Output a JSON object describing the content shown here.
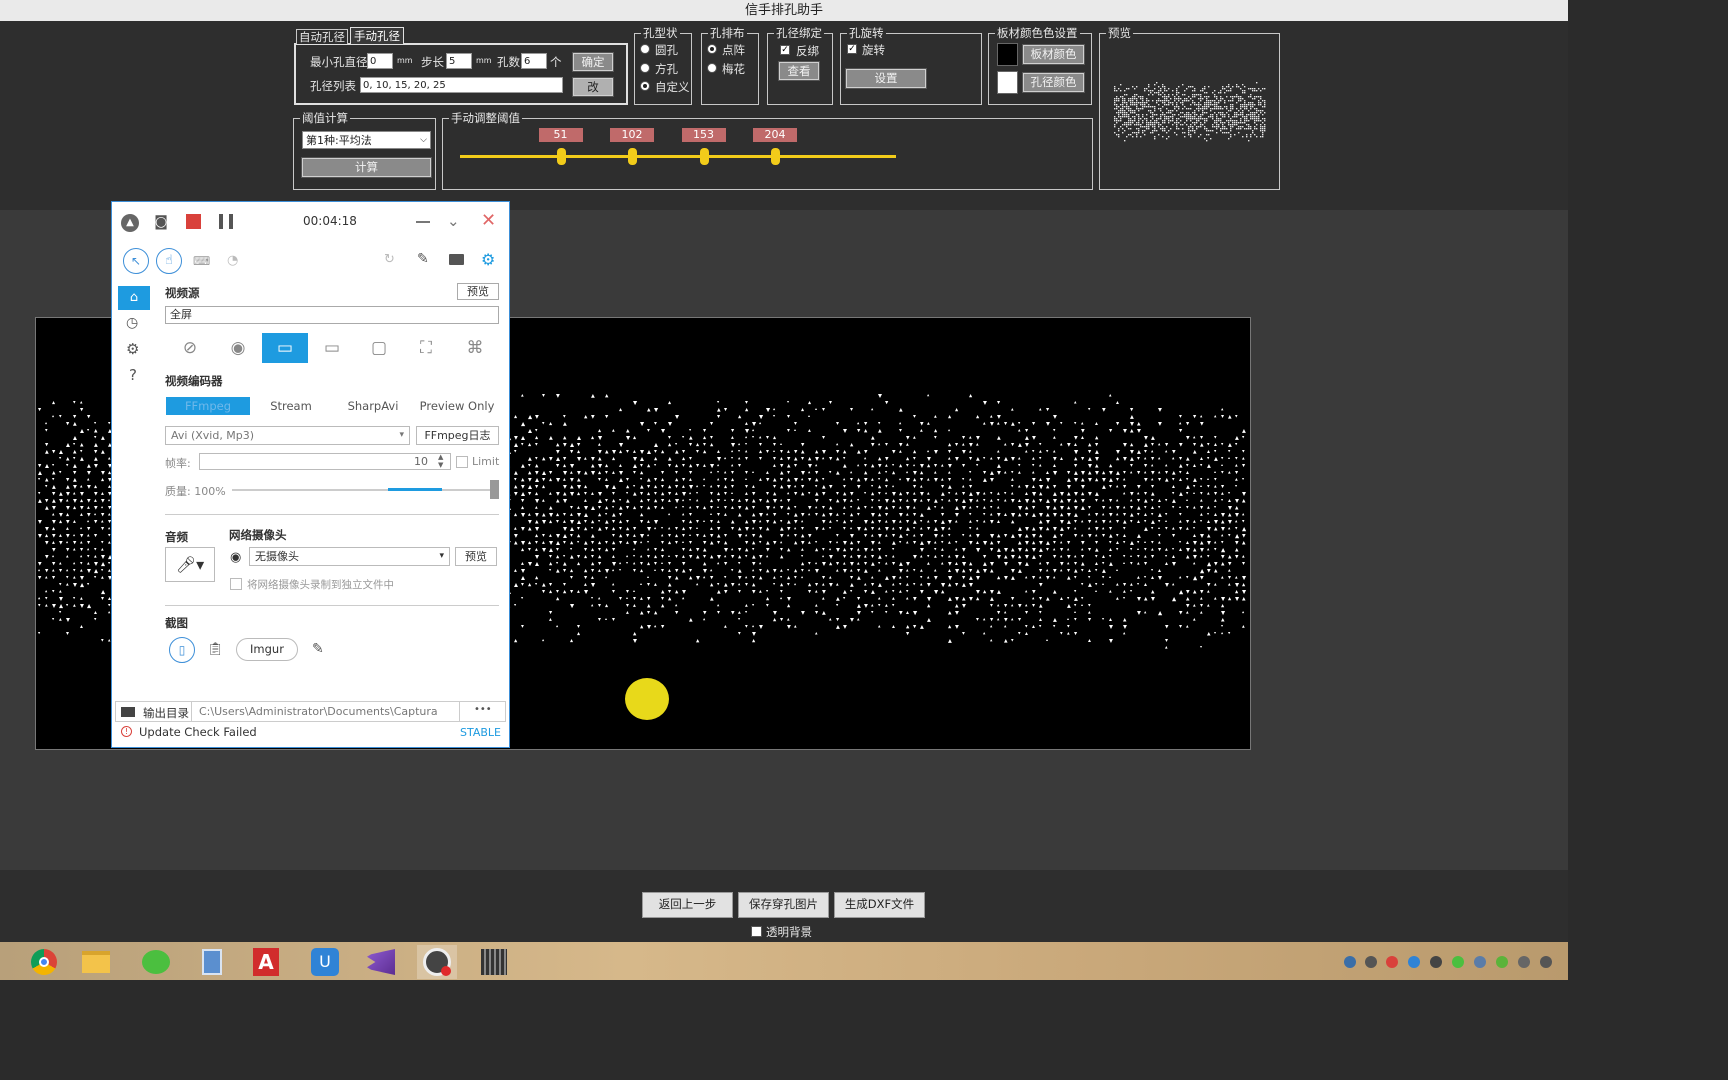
{
  "app": {
    "title": "信手排孔助手"
  },
  "aperture": {
    "tabs": [
      "自动孔径",
      "手动孔径"
    ],
    "active_tab": "手动孔径",
    "min_diameter_label": "最小孔直径",
    "min_diameter_value": "0",
    "unit_mm": "mm",
    "step_label": "步长",
    "step_value": "5",
    "count_label": "孔数",
    "count_value": "6",
    "count_unit": "个",
    "confirm_label": "确定",
    "list_label": "孔径列表",
    "list_value": "0, 10, 15, 20, 25",
    "edit_label": "改"
  },
  "hole_shape": {
    "title": "孔型状",
    "options": [
      "圆孔",
      "方孔",
      "自定义"
    ],
    "selected": "自定义"
  },
  "hole_layout": {
    "title": "孔排布",
    "options": [
      "点阵",
      "梅花"
    ],
    "selected": "点阵"
  },
  "hole_bind": {
    "title": "孔径绑定",
    "reverse_label": "反绑",
    "reverse_checked": true,
    "view_label": "查看"
  },
  "hole_rotate": {
    "title": "孔旋转",
    "rotate_label": "旋转",
    "rotate_checked": true,
    "settings_label": "设置"
  },
  "color_settings": {
    "title": "板材颜色色设置",
    "board_label": "板材颜色",
    "hole_label": "孔径颜色",
    "board_color": "#000000",
    "hole_color": "#ffffff"
  },
  "preview": {
    "title": "预览"
  },
  "threshold": {
    "title": "阈值计算",
    "method": "第1种:平均法",
    "calc_label": "计算"
  },
  "manual_threshold": {
    "title": "手动调整阈值",
    "values": [
      51,
      102,
      153,
      204
    ],
    "slider_max": 255
  },
  "captura": {
    "timer": "00:04:18",
    "video_source_label": "视频源",
    "preview_label": "预览",
    "source_value": "全屏",
    "encoder_label": "视频编码器",
    "encoder_tabs": [
      "FFmpeg",
      "Stream",
      "SharpAvi",
      "Preview Only"
    ],
    "active_encoder": "FFmpeg",
    "codec": "Avi (Xvid, Mp3)",
    "ffmpeg_log_label": "FFmpeg日志",
    "fps_label": "帧率:",
    "fps_value": "10",
    "limit_label": "Limit",
    "quality_label": "质量: 100%",
    "quality_percent": 100,
    "audio_label": "音频",
    "webcam_label": "网络摄像头",
    "webcam_value": "无摄像头",
    "webcam_preview_label": "预览",
    "webcam_separate_label": "将网络摄像头录制到独立文件中",
    "screenshot_label": "截图",
    "imgur_label": "Imgur",
    "output_dir_label": "输出目录",
    "output_dir_value": "C:\\Users\\Administrator\\Documents\\Captura",
    "more_label": "•••",
    "update_status": "Update Check Failed",
    "channel": "STABLE",
    "accent_color": "#1e9be0"
  },
  "bottom": {
    "back_label": "返回上一步",
    "save_label": "保存穿孔图片",
    "dxf_label": "生成DXF文件",
    "transparent_label": "透明背景",
    "transparent_checked": false
  },
  "taskbar": {
    "apps": [
      "chrome-icon",
      "file-explorer-icon",
      "wechat-icon",
      "calculator-icon",
      "acrobat-icon",
      "uu-icon",
      "visual-studio-icon",
      "captura-icon",
      "app-grid-icon"
    ]
  }
}
